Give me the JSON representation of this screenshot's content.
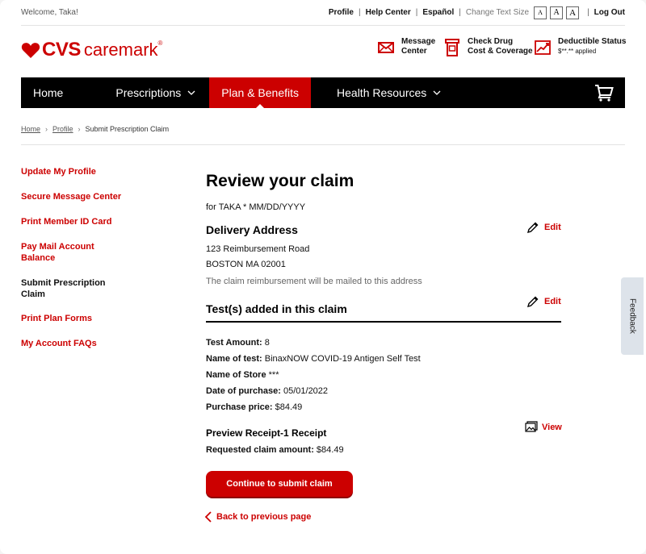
{
  "utility_bar": {
    "welcome": "Welcome, Taka!",
    "profile": "Profile",
    "help_center": "Help Center",
    "espanol": "Español",
    "change_text_size": "Change Text Size",
    "size_small": "A",
    "size_medium": "A",
    "size_large": "A",
    "log_out": "Log Out"
  },
  "logo": {
    "cvs": "CVS",
    "caremark": "caremark",
    "reg": "®"
  },
  "quick_links": [
    {
      "line1": "Message",
      "line2": "Center",
      "icon": "envelope-icon"
    },
    {
      "line1": "Check Drug",
      "line2": "Cost & Coverage",
      "icon": "pill-bottle-icon"
    },
    {
      "line1": "Deductible Status",
      "line2": "$**.** applied",
      "icon": "chart-icon"
    }
  ],
  "nav": {
    "home": "Home",
    "prescriptions": "Prescriptions",
    "plan_benefits": "Plan & Benefits",
    "health_resources": "Health Resources",
    "cart_icon": "cart-icon"
  },
  "breadcrumb": {
    "home": "Home",
    "profile": "Profile",
    "current": "Submit Prescription Claim"
  },
  "sidebar": {
    "items": [
      {
        "label": "Update My Profile"
      },
      {
        "label": "Secure Message Center"
      },
      {
        "label": "Print Member ID Card"
      },
      {
        "label": "Pay Mail Account Balance"
      },
      {
        "label": "Submit Prescription Claim"
      },
      {
        "label": "Print Plan Forms"
      },
      {
        "label": "My Account FAQs"
      }
    ]
  },
  "main": {
    "title": "Review your claim",
    "for_line": "for TAKA * MM/DD/YYYY",
    "delivery": {
      "heading": "Delivery Address",
      "edit": "Edit",
      "line1": "123 Reimbursement Road",
      "line2": "BOSTON MA 02001",
      "note": "The claim reimbursement will be mailed to this address"
    },
    "tests": {
      "heading": "Test(s) added in this claim",
      "edit": "Edit",
      "amount_label": "Test Amount:",
      "amount_value": "8",
      "name_label": "Name of test:",
      "name_value": "BinaxNOW COVID-19 Antigen Self Test",
      "store_label": "Name of Store",
      "store_value": "***",
      "date_label": "Date of purchase:",
      "date_value": "05/01/2022",
      "price_label": "Purchase price:",
      "price_value": "$84.49"
    },
    "receipt": {
      "heading": "Preview Receipt-1 Receipt",
      "view": "View",
      "requested_label": "Requested claim amount:",
      "requested_value": "$84.49"
    },
    "continue_button": "Continue to submit claim",
    "back_link": "Back to previous page"
  },
  "feedback": "Feedback",
  "colors": {
    "brand_red": "#cc0000",
    "nav_black": "#000000"
  }
}
